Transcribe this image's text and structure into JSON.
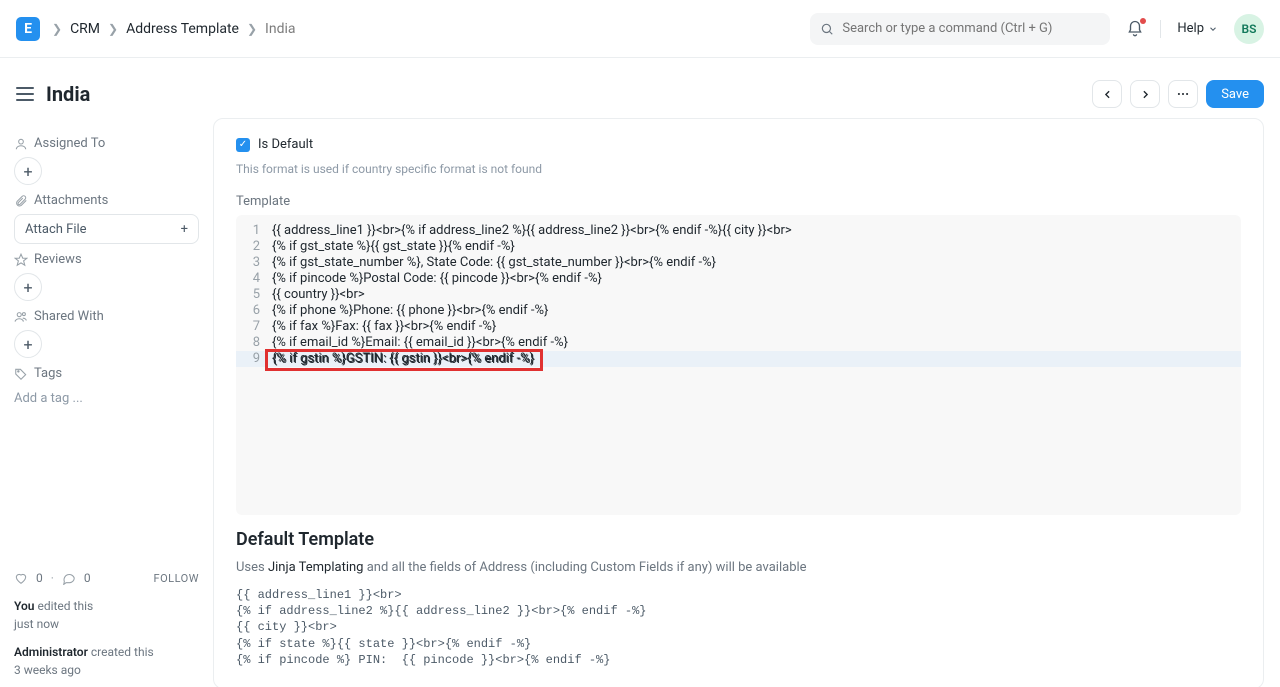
{
  "header": {
    "logo_letter": "E",
    "breadcrumbs": [
      {
        "label": "CRM"
      },
      {
        "label": "Address Template"
      },
      {
        "label": "India",
        "current": true
      }
    ],
    "search_placeholder": "Search or type a command (Ctrl + G)",
    "help_label": "Help",
    "avatar_initials": "BS"
  },
  "page": {
    "title": "India",
    "actions": {
      "save_label": "Save"
    }
  },
  "sidebar": {
    "assigned_to_label": "Assigned To",
    "attachments_label": "Attachments",
    "attach_file_label": "Attach File",
    "reviews_label": "Reviews",
    "shared_with_label": "Shared With",
    "tags_label": "Tags",
    "add_tag_placeholder": "Add a tag ...",
    "likes_count": "0",
    "comments_count": "0",
    "follow_label": "FOLLOW",
    "activity": [
      {
        "who": "You",
        "action": " edited this",
        "when": "just now"
      },
      {
        "who": "Administrator",
        "action": " created this",
        "when": "3 weeks ago"
      }
    ]
  },
  "main": {
    "is_default": {
      "label": "Is Default",
      "checked": true
    },
    "is_default_help": "This format is used if country specific format is not found",
    "template_label": "Template",
    "code_lines": [
      "{{ address_line1 }}<br>{% if address_line2 %}{{ address_line2 }}<br>{% endif -%}{{ city }}<br>",
      "{% if gst_state %}{{ gst_state }}{% endif -%}",
      "{% if gst_state_number %}, State Code: {{ gst_state_number }}<br>{% endif -%}",
      "{% if pincode %}Postal Code: {{ pincode }}<br>{% endif -%}",
      "{{ country }}<br>",
      "{% if phone %}Phone: {{ phone }}<br>{% endif -%}",
      "{% if fax %}Fax: {{ fax }}<br>{% endif -%}",
      "{% if email_id %}Email: {{ email_id }}<br>{% endif -%}",
      "{% if gstin %}GSTIN: {{ gstin }}<br>{% endif -%}"
    ],
    "highlight_line_index": 8,
    "default_template_title": "Default Template",
    "default_template_desc_prefix": "Uses ",
    "default_template_link_label": "Jinja Templating",
    "default_template_desc_suffix": " and all the fields of Address (including Custom Fields if any) will be available",
    "default_template_code": "{{ address_line1 }}<br>\n{% if address_line2 %}{{ address_line2 }}<br>{% endif -%}\n{{ city }}<br>\n{% if state %}{{ state }}<br>{% endif -%}\n{% if pincode %} PIN:  {{ pincode }}<br>{% endif -%}"
  }
}
